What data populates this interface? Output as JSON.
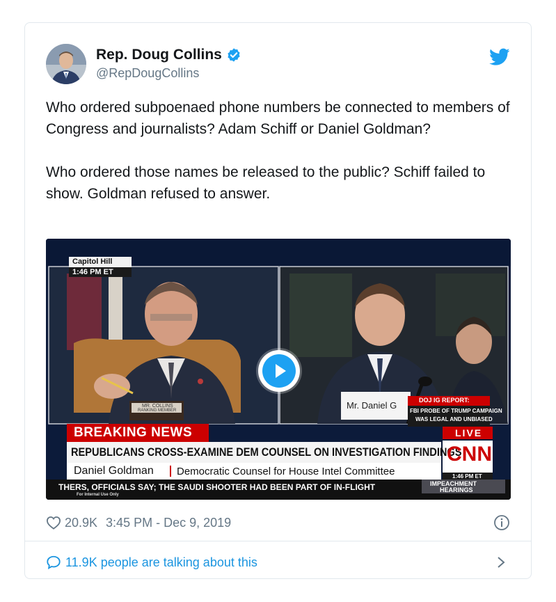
{
  "tweet": {
    "author_name": "Rep. Doug Collins",
    "author_handle": "@RepDougCollins",
    "paragraph_1": "Who ordered subpoenaed phone numbers be connected to members of Congress and journalists? Adam Schiff or Daniel Goldman?",
    "paragraph_2": "Who ordered those names be released to the public? Schiff failed to show. Goldman refused to answer.",
    "likes": "20.9K",
    "time": "3:45 PM - Dec 9, 2019",
    "talking": "11.9K people are talking about this"
  },
  "video": {
    "location": "Capitol Hill",
    "clock": "1:46 PM ET",
    "nameplate_left_line1": "MR. COLLINS",
    "nameplate_left_line2": "RANKING MEMBER",
    "nameplate_right": "Mr. Daniel G",
    "doj_title": "DOJ IG REPORT:",
    "doj_line1": "FBI PROBE OF TRUMP CAMPAIGN",
    "doj_line2": "WAS LEGAL AND UNBIASED",
    "breaking": "BREAKING NEWS",
    "headline": "REPUBLICANS CROSS-EXAMINE DEM COUNSEL ON INVESTIGATION FINDINGS",
    "guest_name": "Daniel Goldman",
    "guest_title": "Democratic Counsel for House Intel Committee",
    "live": "LIVE",
    "network": "CNN",
    "network_time": "1:46 PM ET",
    "ticker": "THERS, OFFICIALS SAY; THE SAUDI SHOOTER HAD BEEN PART OF IN-FLIGHT",
    "program_line1": "IMPEACHMENT",
    "program_line2": "HEARINGS",
    "internal": "For Internal Use Only"
  },
  "colors": {
    "twitter_blue": "#1da1f2",
    "link_blue": "#1b95e0",
    "gray": "#657786",
    "cnn_red": "#cc0000"
  },
  "icons": [
    "verified-badge-icon",
    "twitter-bird-icon",
    "play-icon",
    "heart-icon",
    "info-icon",
    "speech-bubble-icon",
    "chevron-right-icon"
  ]
}
